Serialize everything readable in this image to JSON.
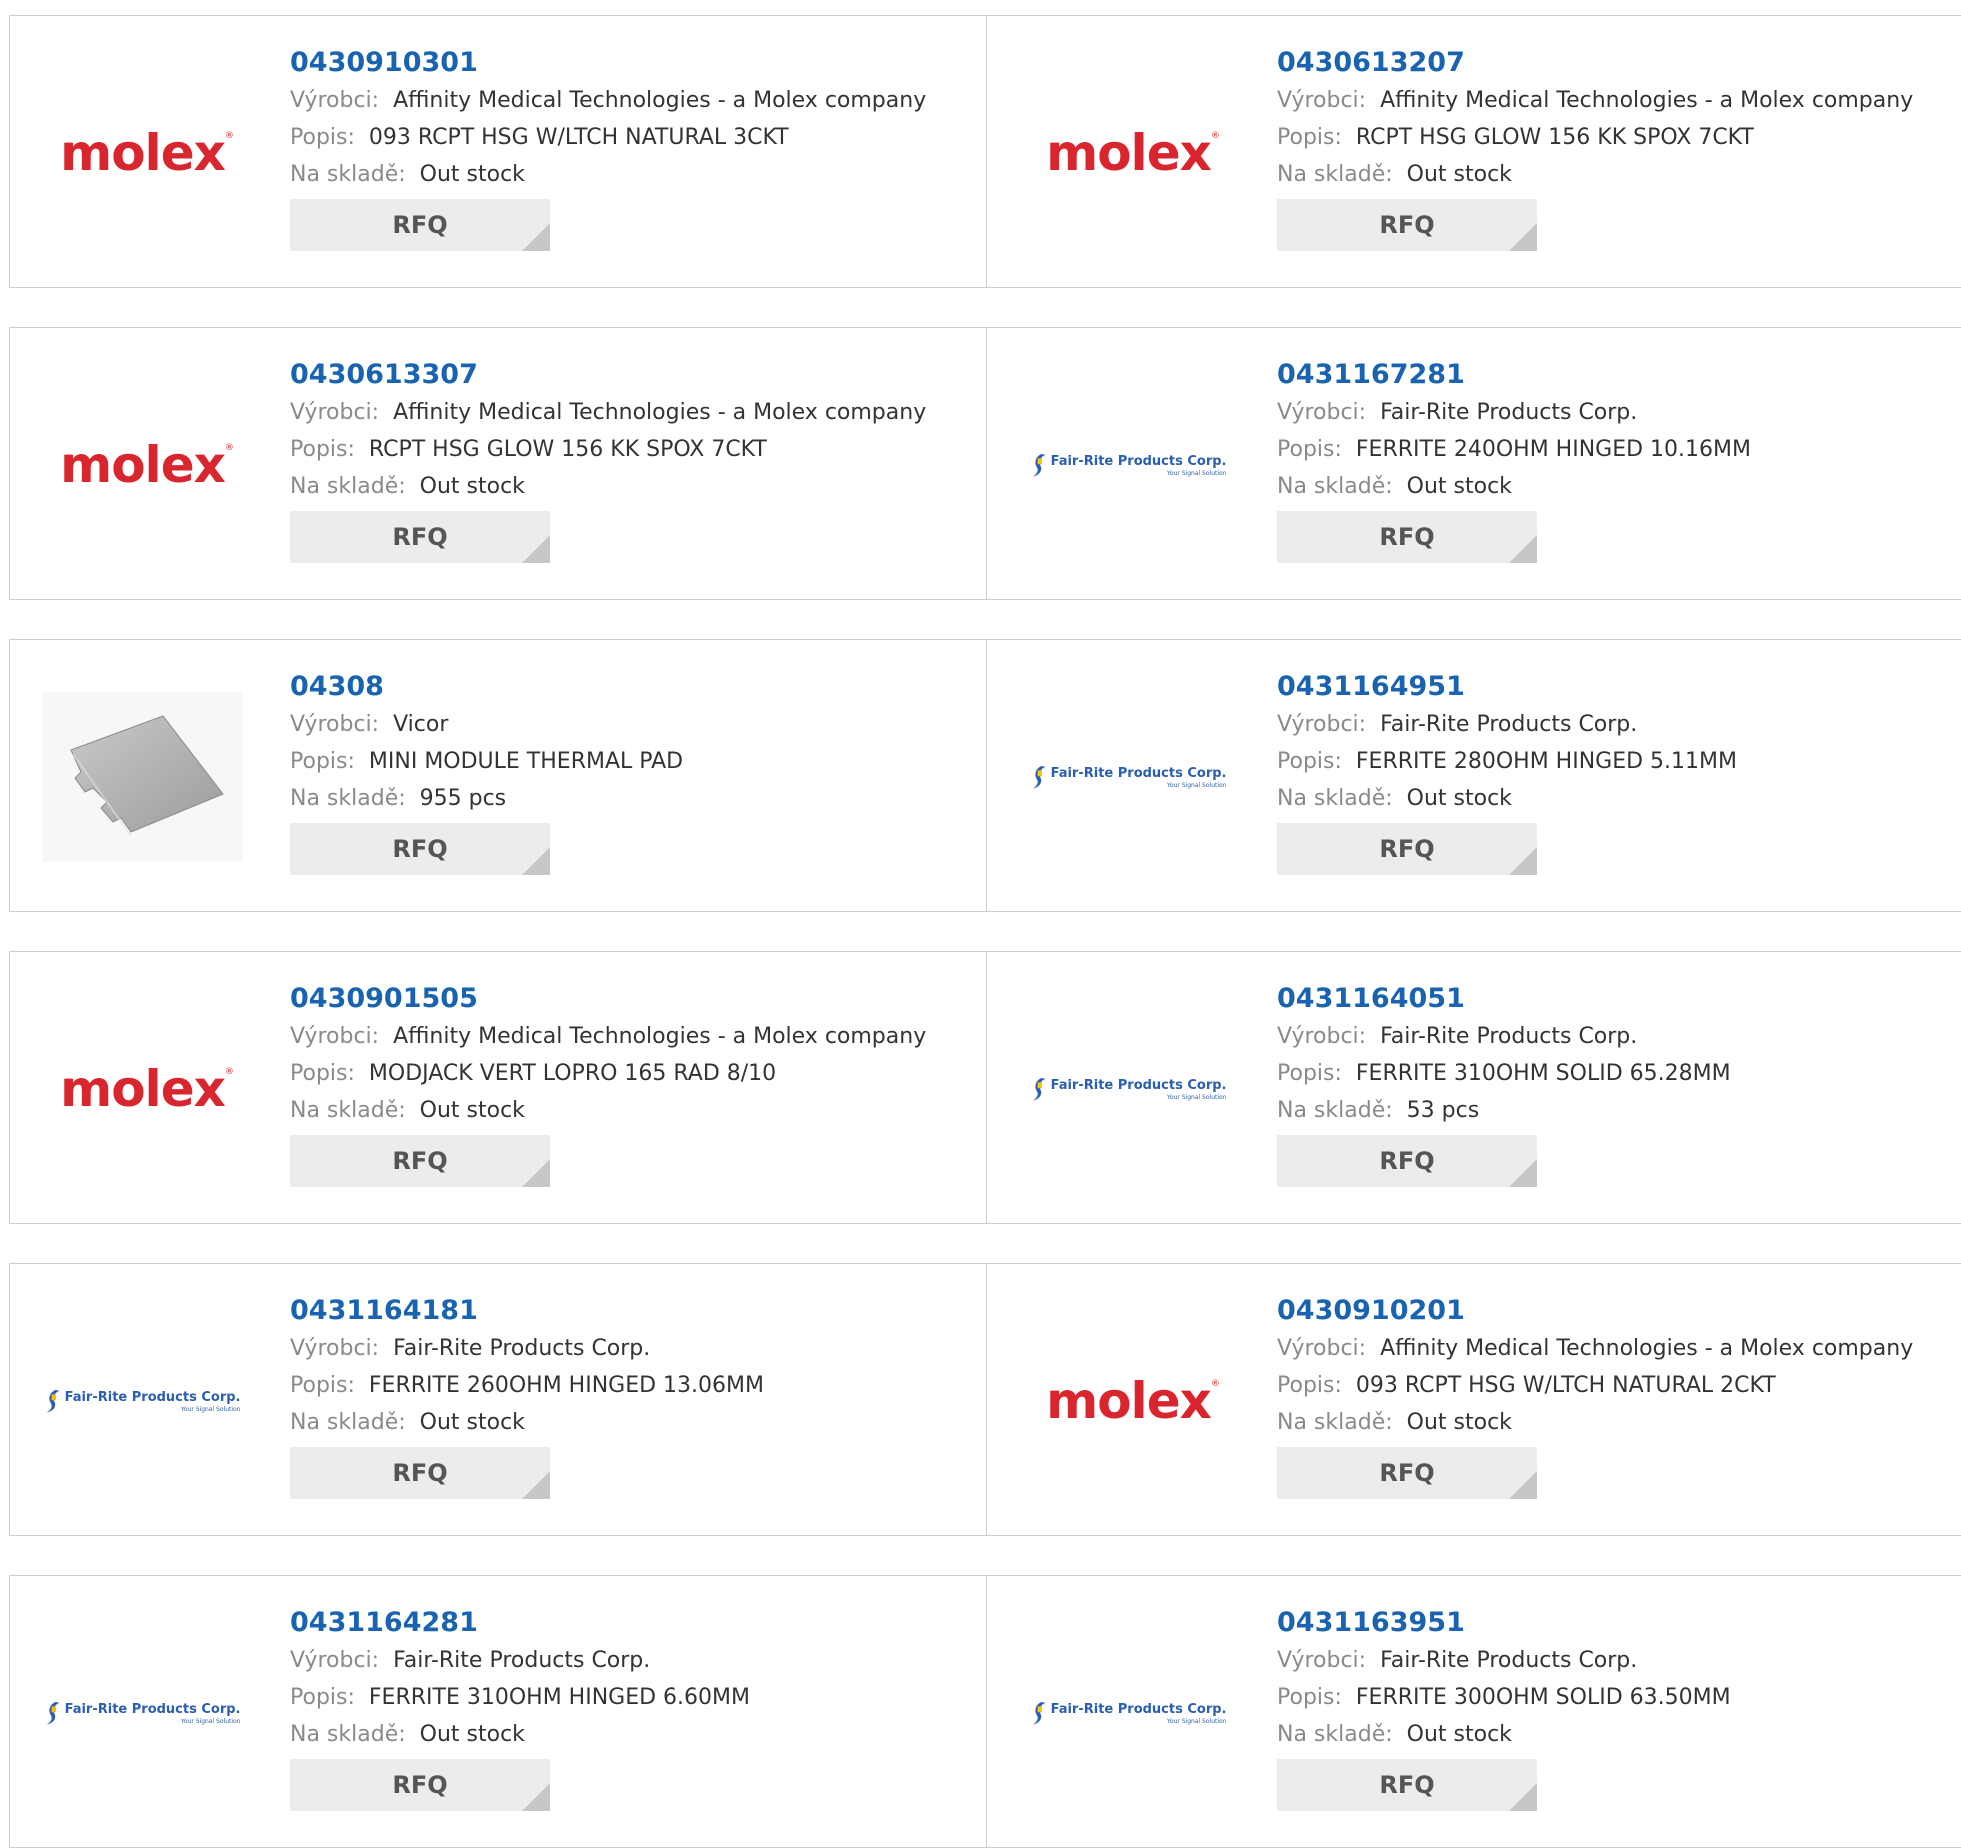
{
  "labels": {
    "manufacturer": "Výrobci:",
    "description": "Popis:",
    "stock": "Na skladě:",
    "rfq": "RFQ"
  },
  "brands": {
    "molex": {
      "logo_text": "molex",
      "mark": "®",
      "color": "#d9262e"
    },
    "fairrite": {
      "logo_text": "Fair-Rite Products Corp.",
      "tagline": "Your Signal Solution",
      "color": "#2b5fae"
    }
  },
  "colors": {
    "part_link": "#1a63b0",
    "label": "#8a8a8a",
    "button_bg": "#ececec"
  },
  "products": [
    {
      "part": "0430910301",
      "logo": "molex",
      "manufacturer": "Affinity Medical Technologies - a Molex company",
      "description": "093 RCPT HSG W/LTCH NATURAL 3CKT",
      "stock": "Out stock"
    },
    {
      "part": "0430613207",
      "logo": "molex",
      "manufacturer": "Affinity Medical Technologies - a Molex company",
      "description": "RCPT HSG GLOW 156 KK SPOX 7CKT",
      "stock": "Out stock"
    },
    {
      "part": "0430613307",
      "logo": "molex",
      "manufacturer": "Affinity Medical Technologies - a Molex company",
      "description": "RCPT HSG GLOW 156 KK SPOX 7CKT",
      "stock": "Out stock"
    },
    {
      "part": "0431167281",
      "logo": "fairrite",
      "manufacturer": "Fair-Rite Products Corp.",
      "description": "FERRITE 240OHM HINGED 10.16MM",
      "stock": "Out stock"
    },
    {
      "part": "04308",
      "logo": "pad",
      "manufacturer": "Vicor",
      "description": "MINI MODULE THERMAL PAD",
      "stock": "955 pcs"
    },
    {
      "part": "0431164951",
      "logo": "fairrite",
      "manufacturer": "Fair-Rite Products Corp.",
      "description": "FERRITE 280OHM HINGED 5.11MM",
      "stock": "Out stock"
    },
    {
      "part": "0430901505",
      "logo": "molex",
      "manufacturer": "Affinity Medical Technologies - a Molex company",
      "description": "MODJACK VERT LOPRO 165 RAD 8/10",
      "stock": "Out stock"
    },
    {
      "part": "0431164051",
      "logo": "fairrite",
      "manufacturer": "Fair-Rite Products Corp.",
      "description": "FERRITE 310OHM SOLID 65.28MM",
      "stock": "53 pcs"
    },
    {
      "part": "0431164181",
      "logo": "fairrite",
      "manufacturer": "Fair-Rite Products Corp.",
      "description": "FERRITE 260OHM HINGED 13.06MM",
      "stock": "Out stock"
    },
    {
      "part": "0430910201",
      "logo": "molex",
      "manufacturer": "Affinity Medical Technologies - a Molex company",
      "description": "093 RCPT HSG W/LTCH NATURAL 2CKT",
      "stock": "Out stock"
    },
    {
      "part": "0431164281",
      "logo": "fairrite",
      "manufacturer": "Fair-Rite Products Corp.",
      "description": "FERRITE 310OHM HINGED 6.60MM",
      "stock": "Out stock"
    },
    {
      "part": "0431163951",
      "logo": "fairrite",
      "manufacturer": "Fair-Rite Products Corp.",
      "description": "FERRITE 300OHM SOLID 63.50MM",
      "stock": "Out stock"
    }
  ]
}
